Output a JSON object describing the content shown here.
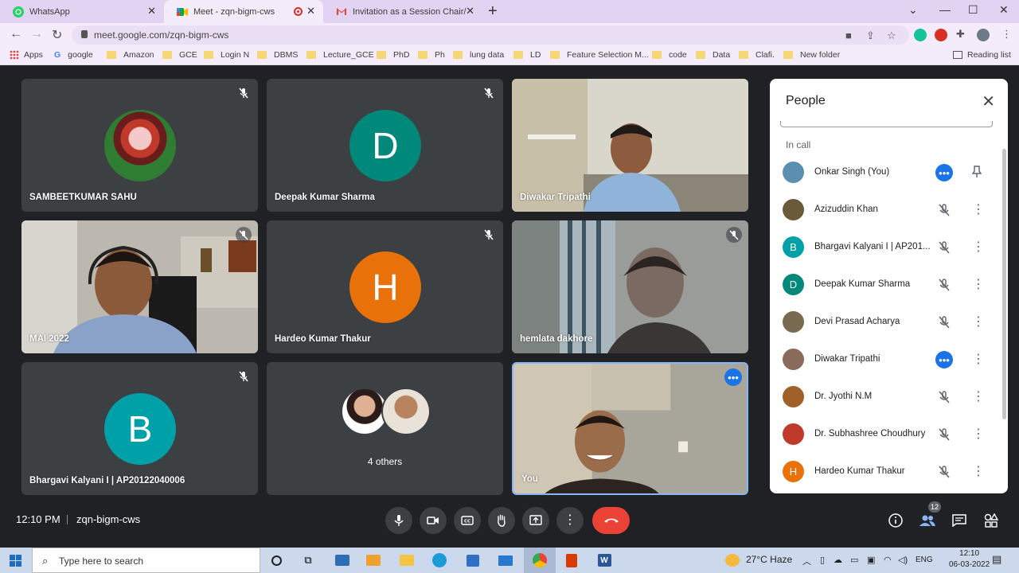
{
  "browser": {
    "tabs": [
      {
        "title": "WhatsApp",
        "active": false
      },
      {
        "title": "Meet - zqn-bigm-cws",
        "active": true
      },
      {
        "title": "Invitation as a Session Chair/ Co-",
        "active": false
      }
    ],
    "url": "meet.google.com/zqn-bigm-cws",
    "bookmarks": [
      "Apps",
      "google",
      "Amazon",
      "GCE",
      "Login N",
      "DBMS",
      "Lecture_GCE",
      "PhD",
      "Ph",
      "lung data",
      "LD",
      "Feature Selection M...",
      "code",
      "Data",
      "Clafi.",
      "New folder"
    ],
    "reading_list": "Reading list"
  },
  "tiles": [
    {
      "name": "SAMBEETKUMAR SAHU"
    },
    {
      "name": "Deepak Kumar Sharma",
      "letter": "D"
    },
    {
      "name": "Diwakar Tripathi"
    },
    {
      "name": "MAI 2022"
    },
    {
      "name": "Hardeo Kumar Thakur",
      "letter": "H"
    },
    {
      "name": "hemlata dakhore"
    },
    {
      "name": "Bhargavi Kalyani I | AP20122040006",
      "letter": "B"
    },
    {
      "name": "4 others"
    },
    {
      "name": "You"
    }
  ],
  "people_panel": {
    "title": "People",
    "section": "In call",
    "participants": [
      {
        "name": "Onkar Singh (You)",
        "letter": ""
      },
      {
        "name": "Azizuddin Khan",
        "letter": ""
      },
      {
        "name": "Bhargavi Kalyani I | AP201...",
        "letter": "B"
      },
      {
        "name": "Deepak Kumar Sharma",
        "letter": "D"
      },
      {
        "name": "Devi Prasad Acharya",
        "letter": ""
      },
      {
        "name": "Diwakar Tripathi",
        "letter": ""
      },
      {
        "name": "Dr. Jyothi N.M",
        "letter": ""
      },
      {
        "name": "Dr. Subhashree Choudhury",
        "letter": ""
      },
      {
        "name": "Hardeo Kumar Thakur",
        "letter": "H"
      }
    ]
  },
  "bottom_bar": {
    "time": "12:10 PM",
    "meeting_code": "zqn-bigm-cws",
    "people_count": "12"
  },
  "taskbar": {
    "search_placeholder": "Type here to search",
    "weather": "27°C  Haze",
    "language": "ENG",
    "time": "12:10",
    "date": "06-03-2022"
  },
  "colors": {
    "meet_bg": "#202124",
    "tile_bg": "#3c4043",
    "teal": "#00897b",
    "orange": "#e8710a",
    "blue": "#1a73e8",
    "end_call": "#ea4335"
  }
}
